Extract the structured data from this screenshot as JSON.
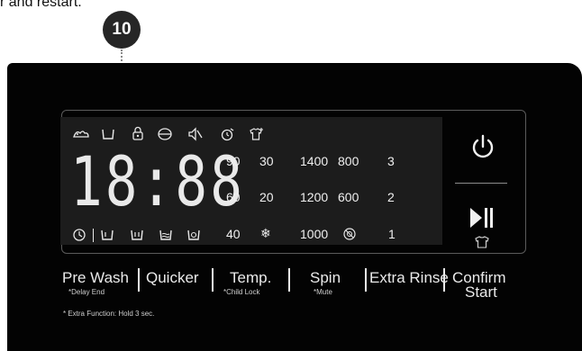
{
  "intro_text": "r and restart.",
  "callout_number": "10",
  "display": {
    "time": "18:88",
    "top_icons": [
      "stain-icon",
      "tub-icon",
      "lock-icon",
      "eco-icon",
      "mute-icon",
      "timer-icon",
      "shirt-plus-icon"
    ],
    "bottom_icons": [
      "clock-icon",
      "prewash-tub-icon",
      "wash-tub-icon",
      "rinse-tub-icon",
      "spin-tub-icon"
    ],
    "temperatures": [
      "90",
      "30",
      "60",
      "20",
      "40"
    ],
    "spin_speeds": [
      "1400",
      "800",
      "1200",
      "600",
      "1000"
    ],
    "rinse_counts": [
      "3",
      "2",
      "1"
    ]
  },
  "buttons": {
    "prewash_label": "Pre Wash",
    "prewash_sub": "*Delay End",
    "quicker_label": "Quicker",
    "temp_label": "Temp.",
    "temp_sub": "*Child Lock",
    "spin_label": "Spin",
    "spin_sub": "*Mute",
    "extra_rinse_label": "Extra Rinse",
    "confirm_label_1": "Confirm",
    "confirm_label_2": "Start"
  },
  "footnote": "* Extra Function: Hold 3 sec.",
  "icons": [
    "power-icon",
    "play-pause-icon",
    "snowflake-icon",
    "no-spin-icon",
    "shirt-small-icon"
  ],
  "colors": {
    "panel": "#030303",
    "lcd": "#1c1c1c",
    "text": "#eaeaea",
    "callout": "#262626"
  }
}
